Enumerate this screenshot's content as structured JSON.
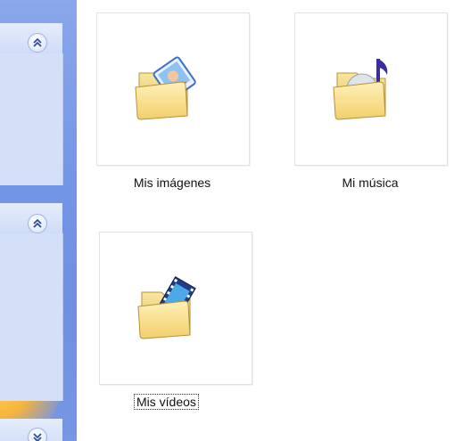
{
  "task_pane": {
    "sections": [
      {
        "collapse_icon": "chevron-double-up-icon"
      },
      {
        "collapse_icon": "chevron-double-up-icon"
      },
      {
        "collapse_icon": "chevron-double-down-icon"
      }
    ]
  },
  "files": [
    {
      "name": "Mis imágenes",
      "icon": "pictures-folder-icon",
      "selected": false
    },
    {
      "name": "Mi música",
      "icon": "music-folder-icon",
      "selected": false
    },
    {
      "name": "Mis vídeos",
      "icon": "videos-folder-icon",
      "selected": true
    }
  ]
}
